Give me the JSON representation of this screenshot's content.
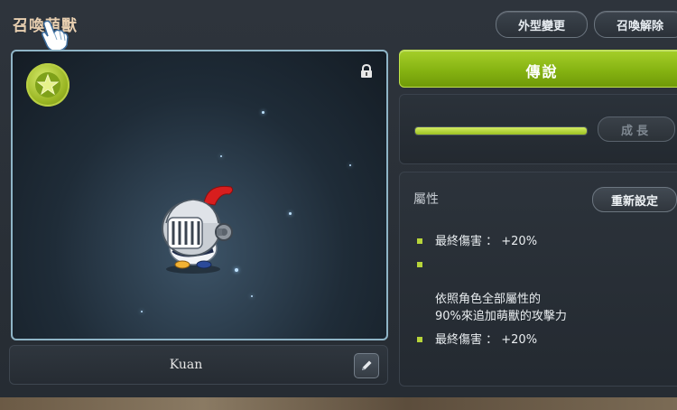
{
  "window": {
    "title": "召喚萌獸"
  },
  "top_buttons": {
    "appearance_change": "外型變更",
    "unsummon": "召喚解除"
  },
  "preview": {
    "pet_name": "Kuan"
  },
  "grade": {
    "label": "傳說"
  },
  "growth": {
    "button_label": "成長",
    "progress": 1.0
  },
  "attributes": {
    "title": "屬性",
    "reset_label": "重新設定",
    "items": [
      {
        "text": "最終傷害 ： +20%"
      },
      {
        "text": "依照角色全部屬性的\n90%來追加萌獸的攻擊力"
      },
      {
        "text": "最終傷害 ： +20%"
      }
    ]
  },
  "colors": {
    "accent_green": "#86b312",
    "bullet_green": "#b7d43a",
    "title_tan": "#e8cfb0"
  },
  "icons": {
    "star": "star-icon",
    "lock": "lock-icon",
    "edit": "pencil-icon",
    "cursor": "hand-cursor-icon"
  }
}
